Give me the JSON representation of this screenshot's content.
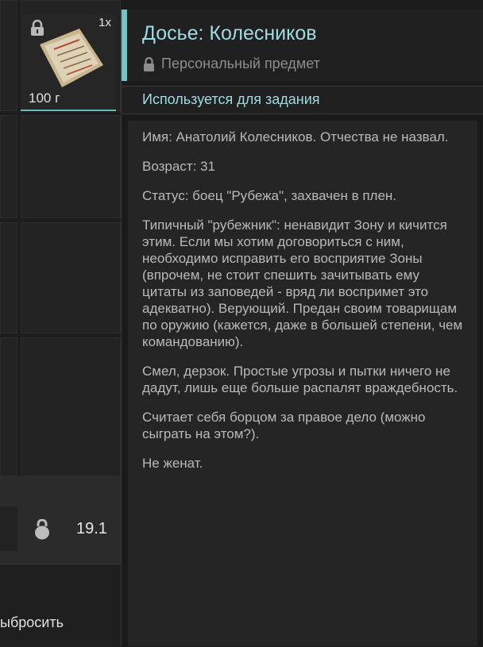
{
  "item": {
    "quantity": "1x",
    "weight": "100 г",
    "name": "Досье: Колесников",
    "subtitle": "Персональный предмет",
    "quest_label": "Используется для задания",
    "description": [
      "Имя: Анатолий Колесников. Отчества не назвал.",
      "Возраст: 31",
      "Статус: боец \"Рубежа\", захвачен в плен.",
      "Типичный \"рубежник\": ненавидит Зону и кичится этим. Если мы хотим договориться с ним, необходимо исправить его восприятие Зоны (впрочем, не стоит спешить зачитывать ему цитаты из заповедей - вряд ли воспримет это адекватно). Верующий. Предан своим товарищам по оружию (кажется, даже в большей степени, чем командованию).",
      "Смел, дерзок. Простые угрозы и пытки ничего не дадут, лишь еще больше распалят враждебность.",
      "Считает себя борцом за правое дело (можно сыграть на этом?).",
      "Не женат."
    ]
  },
  "inventory": {
    "total_weight": "19.1",
    "drop_label": "ыбросить"
  },
  "colors": {
    "accent": "#77c2c4",
    "title": "#9fdbe0"
  },
  "icons": {
    "item_lock": "lock-icon",
    "weight": "kettlebell-icon"
  }
}
